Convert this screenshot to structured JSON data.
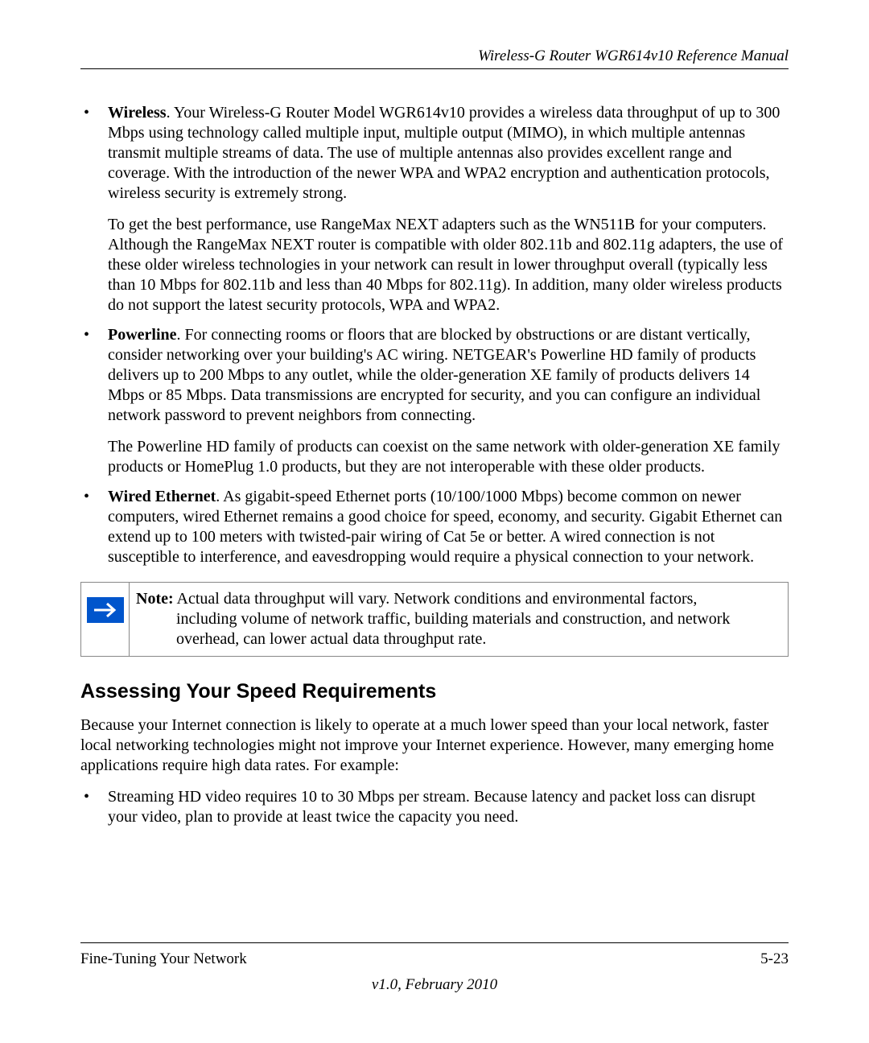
{
  "header": {
    "title": "Wireless-G Router WGR614v10 Reference Manual"
  },
  "bullets": [
    {
      "lead": "Wireless",
      "para1_rest": ". Your Wireless-G Router Model WGR614v10 provides a wireless data throughput of up to 300 Mbps using technology called multiple input, multiple output (MIMO), in which multiple antennas transmit multiple streams of data. The use of multiple antennas also provides excellent range and coverage. With the introduction of the newer WPA and WPA2 encryption and authentication protocols, wireless security is extremely strong.",
      "para2": "To get the best performance, use RangeMax NEXT adapters such as the WN511B for your computers. Although the RangeMax NEXT router is compatible with older 802.11b and 802.11g adapters, the use of these older wireless technologies in your network can result in lower throughput overall (typically less than 10 Mbps for 802.11b and less than 40 Mbps for 802.11g). In addition, many older wireless products do not support the latest security protocols, WPA and WPA2."
    },
    {
      "lead": "Powerline",
      "para1_rest": ". For connecting rooms or floors that are blocked by obstructions or are distant vertically, consider networking over your building's AC wiring. NETGEAR's Powerline HD family of products delivers up to 200 Mbps to any outlet, while the older-generation XE family of products delivers 14 Mbps or 85 Mbps. Data transmissions are encrypted for security, and you can configure an individual network password to prevent neighbors from connecting.",
      "para2": "The Powerline HD family of products can coexist on the same network with older-generation XE family products or HomePlug 1.0 products, but they are not interoperable with these older products."
    },
    {
      "lead": "Wired Ethernet",
      "para1_rest": ". As gigabit-speed Ethernet ports (10/100/1000 Mbps) become common on newer computers, wired Ethernet remains a good choice for speed, economy, and security. Gigabit Ethernet can extend up to 100 meters with twisted-pair wiring of Cat 5e or better. A wired connection is not susceptible to interference, and eavesdropping would require a physical connection to your network."
    }
  ],
  "note": {
    "label": "Note:",
    "line1_rest": " Actual data throughput will vary. Network conditions and environmental factors,",
    "line2": "including volume of network traffic, building materials and construction, and network overhead, can lower actual data throughput rate."
  },
  "section_heading": "Assessing Your Speed Requirements",
  "section_para": "Because your Internet connection is likely to operate at a much lower speed than your local network, faster local networking technologies might not improve your Internet experience. However, many emerging home applications require high data rates. For example:",
  "section_bullets": [
    "Streaming HD video requires 10 to 30 Mbps per stream. Because latency and packet loss can disrupt your video, plan to provide at least twice the capacity you need."
  ],
  "footer": {
    "left": "Fine-Tuning Your Network",
    "right": "5-23",
    "version": "v1.0, February 2010"
  }
}
